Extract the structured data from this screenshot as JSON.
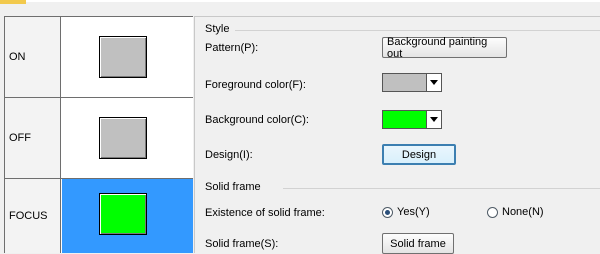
{
  "states": [
    {
      "label": "ON",
      "swatch_color": "#c0c0c0"
    },
    {
      "label": "OFF",
      "swatch_color": "#c0c0c0"
    },
    {
      "label": "FOCUS",
      "swatch_color": "#00ff00",
      "selected": true
    }
  ],
  "style_group": {
    "title": "Style",
    "pattern_label": "Pattern(P):",
    "pattern_button": "Background painting out",
    "foreground_label": "Foreground color(F):",
    "foreground_color": "#c0c0c0",
    "background_label": "Background color(C):",
    "background_color": "#00ff00",
    "design_label": "Design(I):",
    "design_button": "Design"
  },
  "solid_group": {
    "title": "Solid frame",
    "existence_label": "Existence of solid frame:",
    "yes_label": "Yes(Y)",
    "none_label": "None(N)",
    "selected": "yes",
    "solid_frame_label": "Solid frame(S):",
    "solid_frame_button": "Solid frame"
  },
  "colors": {
    "selected_row": "#3399ff"
  }
}
